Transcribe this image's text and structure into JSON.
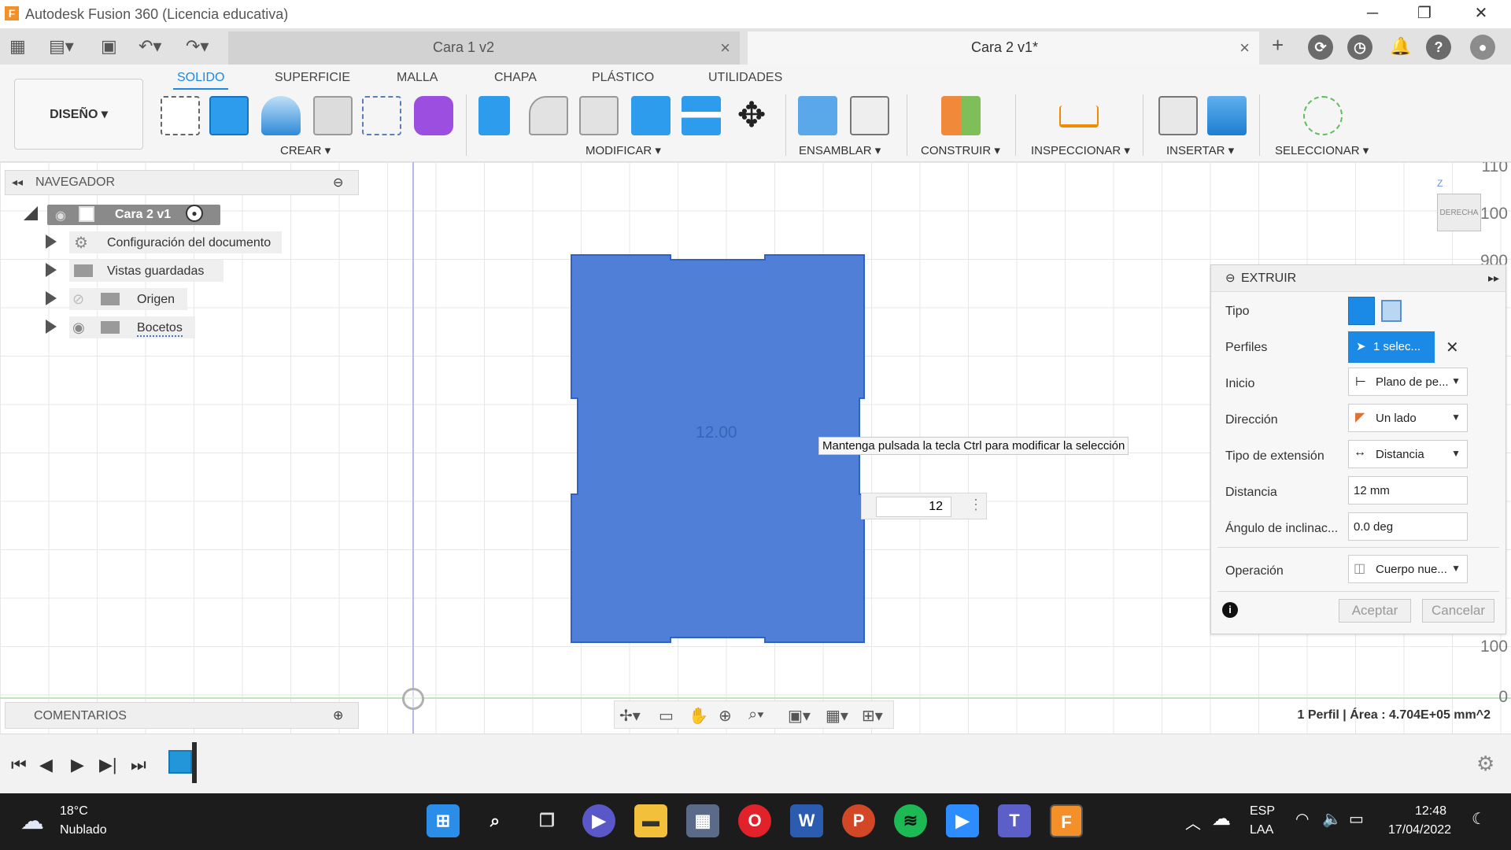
{
  "window": {
    "title": "Autodesk Fusion 360 (Licencia educativa)",
    "logo_letter": "F"
  },
  "tabs": [
    {
      "label": "Cara 1 v2",
      "active": false
    },
    {
      "label": "Cara 2 v1*",
      "active": true
    }
  ],
  "ribbon": {
    "workspace": "DISEÑO ▾",
    "tabs": [
      "SOLIDO",
      "SUPERFICIE",
      "MALLA",
      "CHAPA",
      "PLÁSTICO",
      "UTILIDADES"
    ],
    "groups": [
      "CREAR ▾",
      "MODIFICAR ▾",
      "ENSAMBLAR ▾",
      "CONSTRUIR ▾",
      "INSPECCIONAR ▾",
      "INSERTAR ▾",
      "SELECCIONAR ▾"
    ]
  },
  "navigator": {
    "title": "NAVEGADOR",
    "root": "Cara 2 v1",
    "items": [
      "Configuración del documento",
      "Vistas guardadas",
      "Origen",
      "Bocetos"
    ]
  },
  "comments": {
    "title": "COMENTARIOS"
  },
  "viewport": {
    "dimension_text": "12.00",
    "tooltip": "Mantenga pulsada la tecla Ctrl para modificar la selección",
    "distance_input": "12",
    "viewcube_label": "DERECHA",
    "ruler": [
      "110",
      "100",
      "900",
      "100",
      "0"
    ],
    "axis_z": "Z",
    "status": "1 Perfil | Área : 4.704E+05 mm^2"
  },
  "extrude": {
    "title": "EXTRUIR",
    "rows": [
      {
        "label": "Tipo",
        "value": ""
      },
      {
        "label": "Perfiles",
        "value": "1 selec..."
      },
      {
        "label": "Inicio",
        "value": "Plano de pe..."
      },
      {
        "label": "Dirección",
        "value": "Un lado"
      },
      {
        "label": "Tipo de extensión",
        "value": "Distancia"
      },
      {
        "label": "Distancia",
        "value": "12 mm"
      },
      {
        "label": "Ángulo de inclinac...",
        "value": "0.0 deg"
      },
      {
        "label": "Operación",
        "value": "Cuerpo nue..."
      }
    ],
    "ok": "Aceptar",
    "cancel": "Cancelar"
  },
  "taskbar": {
    "weather_temp": "18°C",
    "weather_desc": "Nublado",
    "lang1": "ESP",
    "lang2": "LAA",
    "time": "12:48",
    "date": "17/04/2022"
  },
  "colors": {
    "accent": "#1a8ae6",
    "profile_fill": "#4f7fd6",
    "profile_stroke": "#2f62c4"
  }
}
